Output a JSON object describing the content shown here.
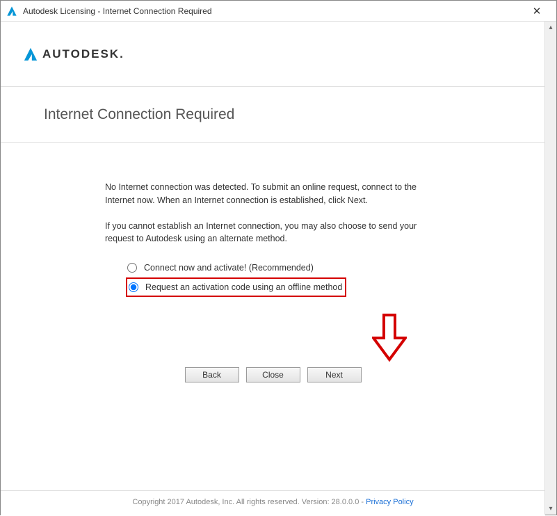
{
  "titlebar": {
    "title": "Autodesk Licensing - Internet Connection Required",
    "close_glyph": "✕"
  },
  "brand": {
    "text": "AUTODESK",
    "trailing_dot": "."
  },
  "page_title": "Internet Connection Required",
  "para1": "No Internet connection was detected. To submit an online request, connect to the Internet now. When an Internet connection is established, click Next.",
  "para2": "If you cannot establish an Internet connection, you may also choose to send your request to Autodesk using an alternate method.",
  "radios": {
    "option_connect": "Connect now and activate! (Recommended)",
    "option_offline": "Request an activation code using an offline method"
  },
  "buttons": {
    "back": "Back",
    "close": "Close",
    "next": "Next"
  },
  "footer": {
    "copyright": "Copyright 2017 Autodesk, Inc. All rights reserved. Version: 28.0.0.0 - ",
    "privacy": "Privacy Policy"
  },
  "scroll_glyphs": {
    "up": "▴",
    "down": "▾"
  }
}
